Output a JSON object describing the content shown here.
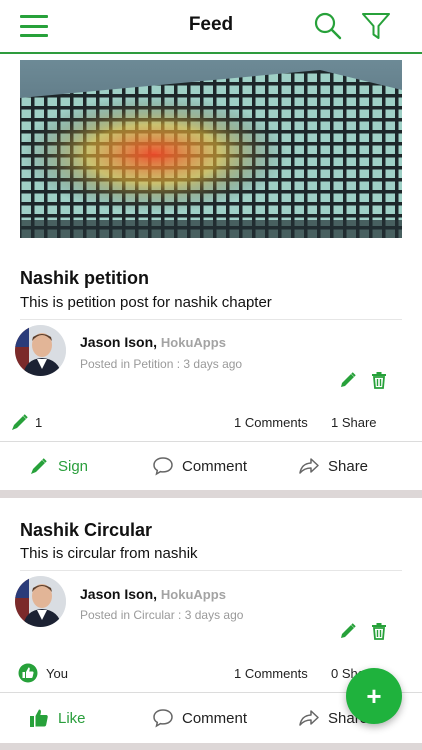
{
  "app": {
    "title": "Feed",
    "accent_color": "#2e9c3e",
    "fab_label": "+"
  },
  "posts": [
    {
      "title": "Nashik petition",
      "body": "This is petition post for nashik chapter",
      "author": "Jason Ison,",
      "org": "HokuApps",
      "meta": "Posted in Petition : 3 days ago",
      "stat_count": "1",
      "comments": "1  Comments",
      "shares": "1  Share",
      "primary_action": "Sign",
      "comment_action": "Comment",
      "share_action": "Share"
    },
    {
      "title": "Nashik Circular",
      "body": "This is circular from nashik",
      "author": "Jason Ison,",
      "org": "HokuApps",
      "meta": "Posted in Circular : 3 days ago",
      "stat_count": "You",
      "comments": "1  Comments",
      "shares": "0  Share",
      "primary_action": "Like",
      "comment_action": "Comment",
      "share_action": "Share"
    }
  ]
}
